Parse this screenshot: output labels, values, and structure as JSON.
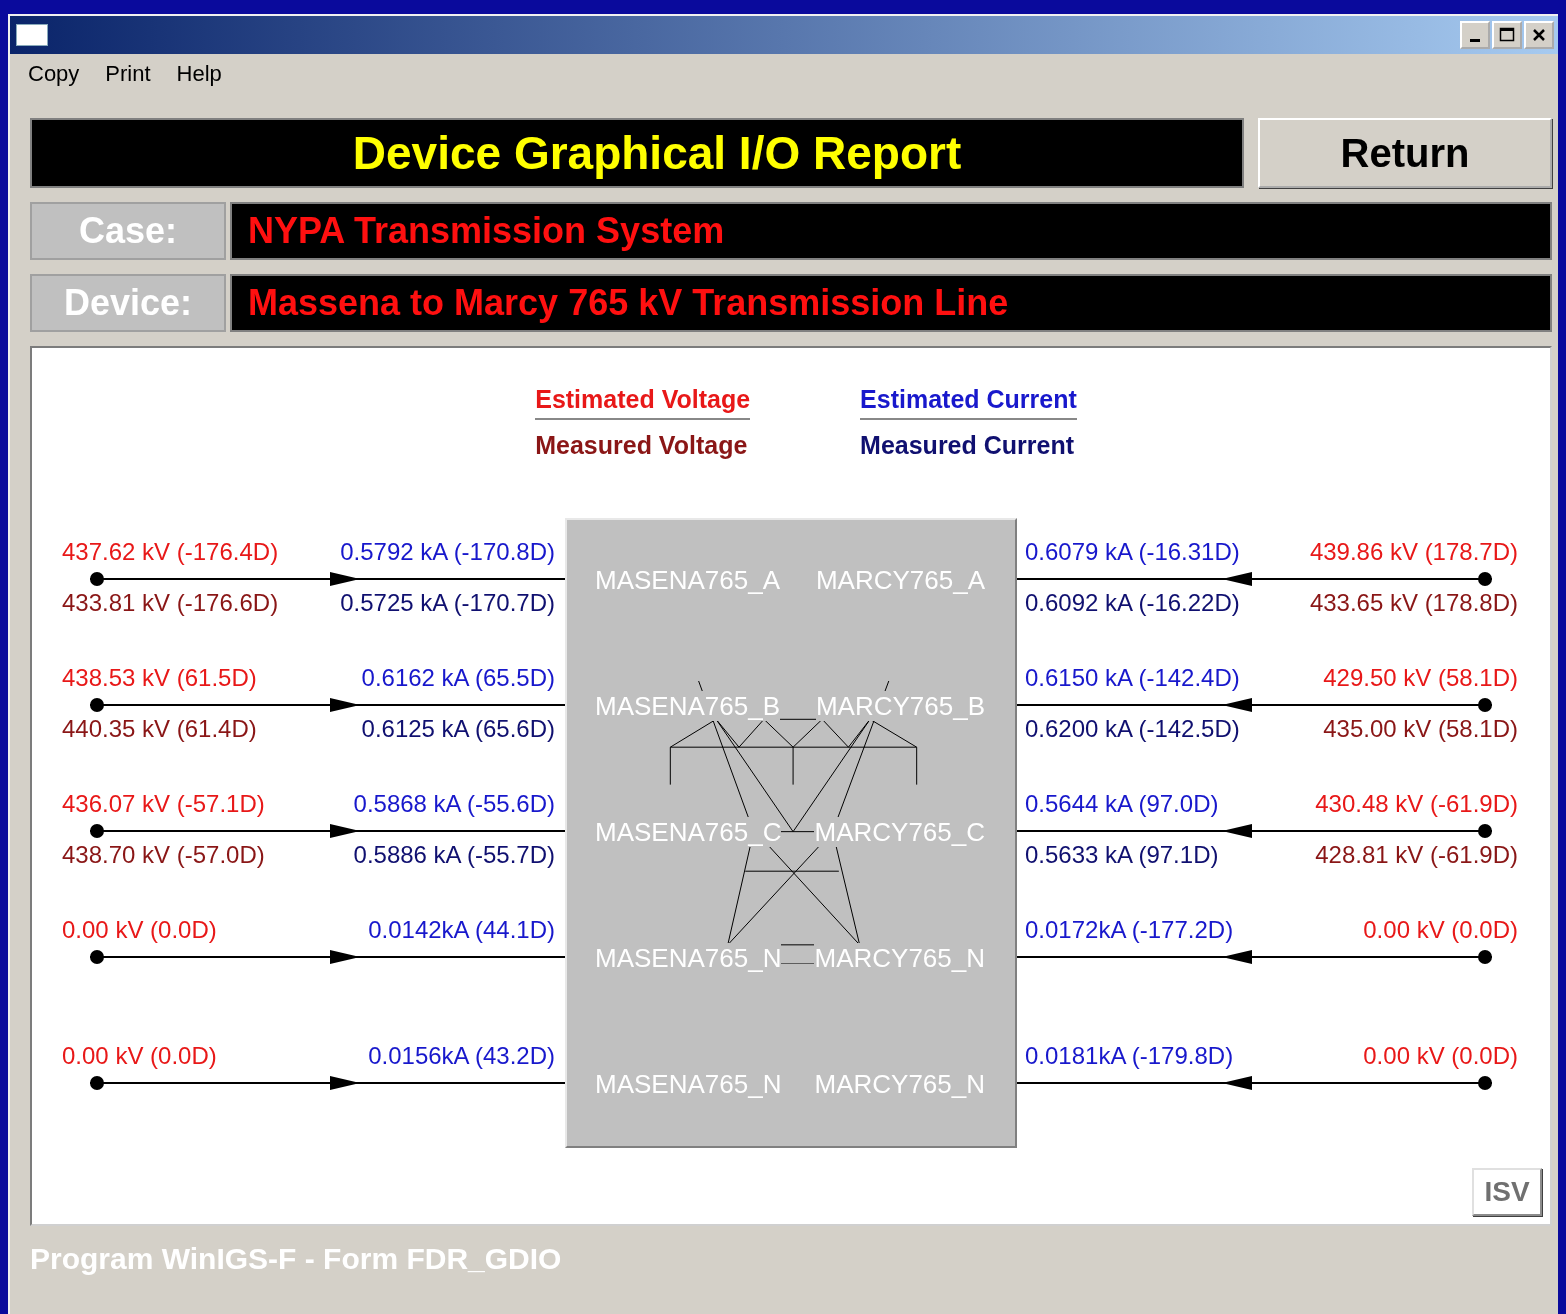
{
  "window": {
    "menu": [
      "Copy",
      "Print",
      "Help"
    ]
  },
  "header": {
    "title": "Device Graphical I/O Report",
    "return_button": "Return"
  },
  "fields": [
    {
      "label": "Case:",
      "value": "NYPA Transmission System"
    },
    {
      "label": "Device:",
      "value": "Massena to Marcy 765 kV Transmission Line"
    }
  ],
  "legend": {
    "estimated_voltage": "Estimated Voltage",
    "estimated_current": "Estimated Current",
    "measured_voltage": "Measured Voltage",
    "measured_current": "Measured Current"
  },
  "phases": [
    {
      "left_bus": "MASENA765_A",
      "right_bus": "MARCY765_A",
      "left": {
        "est_voltage": "437.62 kV (-176.4D)",
        "est_current": "0.5792 kA (-170.8D)",
        "meas_voltage": "433.81 kV (-176.6D)",
        "meas_current": "0.5725 kA (-170.7D)"
      },
      "right": {
        "est_current": "0.6079 kA (-16.31D)",
        "est_voltage": "439.86 kV (178.7D)",
        "meas_current": "0.6092 kA (-16.22D)",
        "meas_voltage": "433.65 kV (178.8D)"
      }
    },
    {
      "left_bus": "MASENA765_B",
      "right_bus": "MARCY765_B",
      "left": {
        "est_voltage": "438.53 kV (61.5D)",
        "est_current": "0.6162 kA (65.5D)",
        "meas_voltage": "440.35 kV (61.4D)",
        "meas_current": "0.6125 kA (65.6D)"
      },
      "right": {
        "est_current": "0.6150 kA (-142.4D)",
        "est_voltage": "429.50 kV (58.1D)",
        "meas_current": "0.6200 kA (-142.5D)",
        "meas_voltage": "435.00 kV (58.1D)"
      }
    },
    {
      "left_bus": "MASENA765_C",
      "right_bus": "MARCY765_C",
      "left": {
        "est_voltage": "436.07 kV (-57.1D)",
        "est_current": "0.5868 kA (-55.6D)",
        "meas_voltage": "438.70 kV (-57.0D)",
        "meas_current": "0.5886 kA (-55.7D)"
      },
      "right": {
        "est_current": "0.5644 kA (97.0D)",
        "est_voltage": "430.48 kV (-61.9D)",
        "meas_current": "0.5633 kA (97.1D)",
        "meas_voltage": "428.81 kV (-61.9D)"
      }
    },
    {
      "left_bus": "MASENA765_N",
      "right_bus": "MARCY765_N",
      "left": {
        "est_voltage": "0.00 kV (0.0D)",
        "est_current": "0.0142kA (44.1D)"
      },
      "right": {
        "est_current": "0.0172kA (-177.2D)",
        "est_voltage": "0.00 kV (0.0D)"
      }
    },
    {
      "left_bus": "MASENA765_N",
      "right_bus": "MARCY765_N",
      "left": {
        "est_voltage": "0.00 kV (0.0D)",
        "est_current": "0.0156kA (43.2D)"
      },
      "right": {
        "est_current": "0.0181kA (-179.8D)",
        "est_voltage": "0.00 kV (0.0D)"
      }
    }
  ],
  "isv_button": "ISV",
  "status_bar": "Program WinIGS-F - Form FDR_GDIO"
}
